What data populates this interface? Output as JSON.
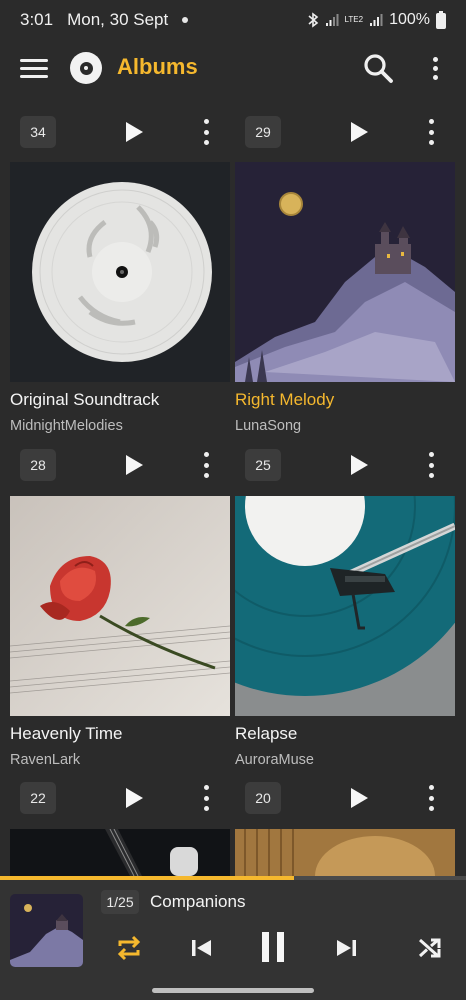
{
  "status_bar": {
    "time": "3:01",
    "date": "Mon, 30 Sept",
    "battery": "100%",
    "network": "LTE2"
  },
  "app_bar": {
    "title": "Albums",
    "icons": [
      "menu-icon",
      "app-logo-disc-icon",
      "search-icon",
      "more-vert-icon"
    ],
    "accent_color": "#f5b82e"
  },
  "top_row_counts": [
    "34",
    "29"
  ],
  "albums": [
    {
      "title": "Original Soundtrack",
      "artist": "MidnightMelodies",
      "count": "28",
      "active": false
    },
    {
      "title": "Right Melody",
      "artist": "LunaSong",
      "count": "25",
      "active": true
    },
    {
      "title": "Heavenly Time",
      "artist": "RavenLark",
      "count": "22",
      "active": false
    },
    {
      "title": "Relapse",
      "artist": "AuroraMuse",
      "count": "20",
      "active": false
    }
  ],
  "mini_player": {
    "position": "1/25",
    "track_title": "Companions",
    "progress": 0.63,
    "controls": [
      "repeat-icon",
      "skip-previous-icon",
      "pause-icon",
      "skip-next-icon",
      "shuffle-icon"
    ],
    "repeat_color": "#f5b82e"
  }
}
